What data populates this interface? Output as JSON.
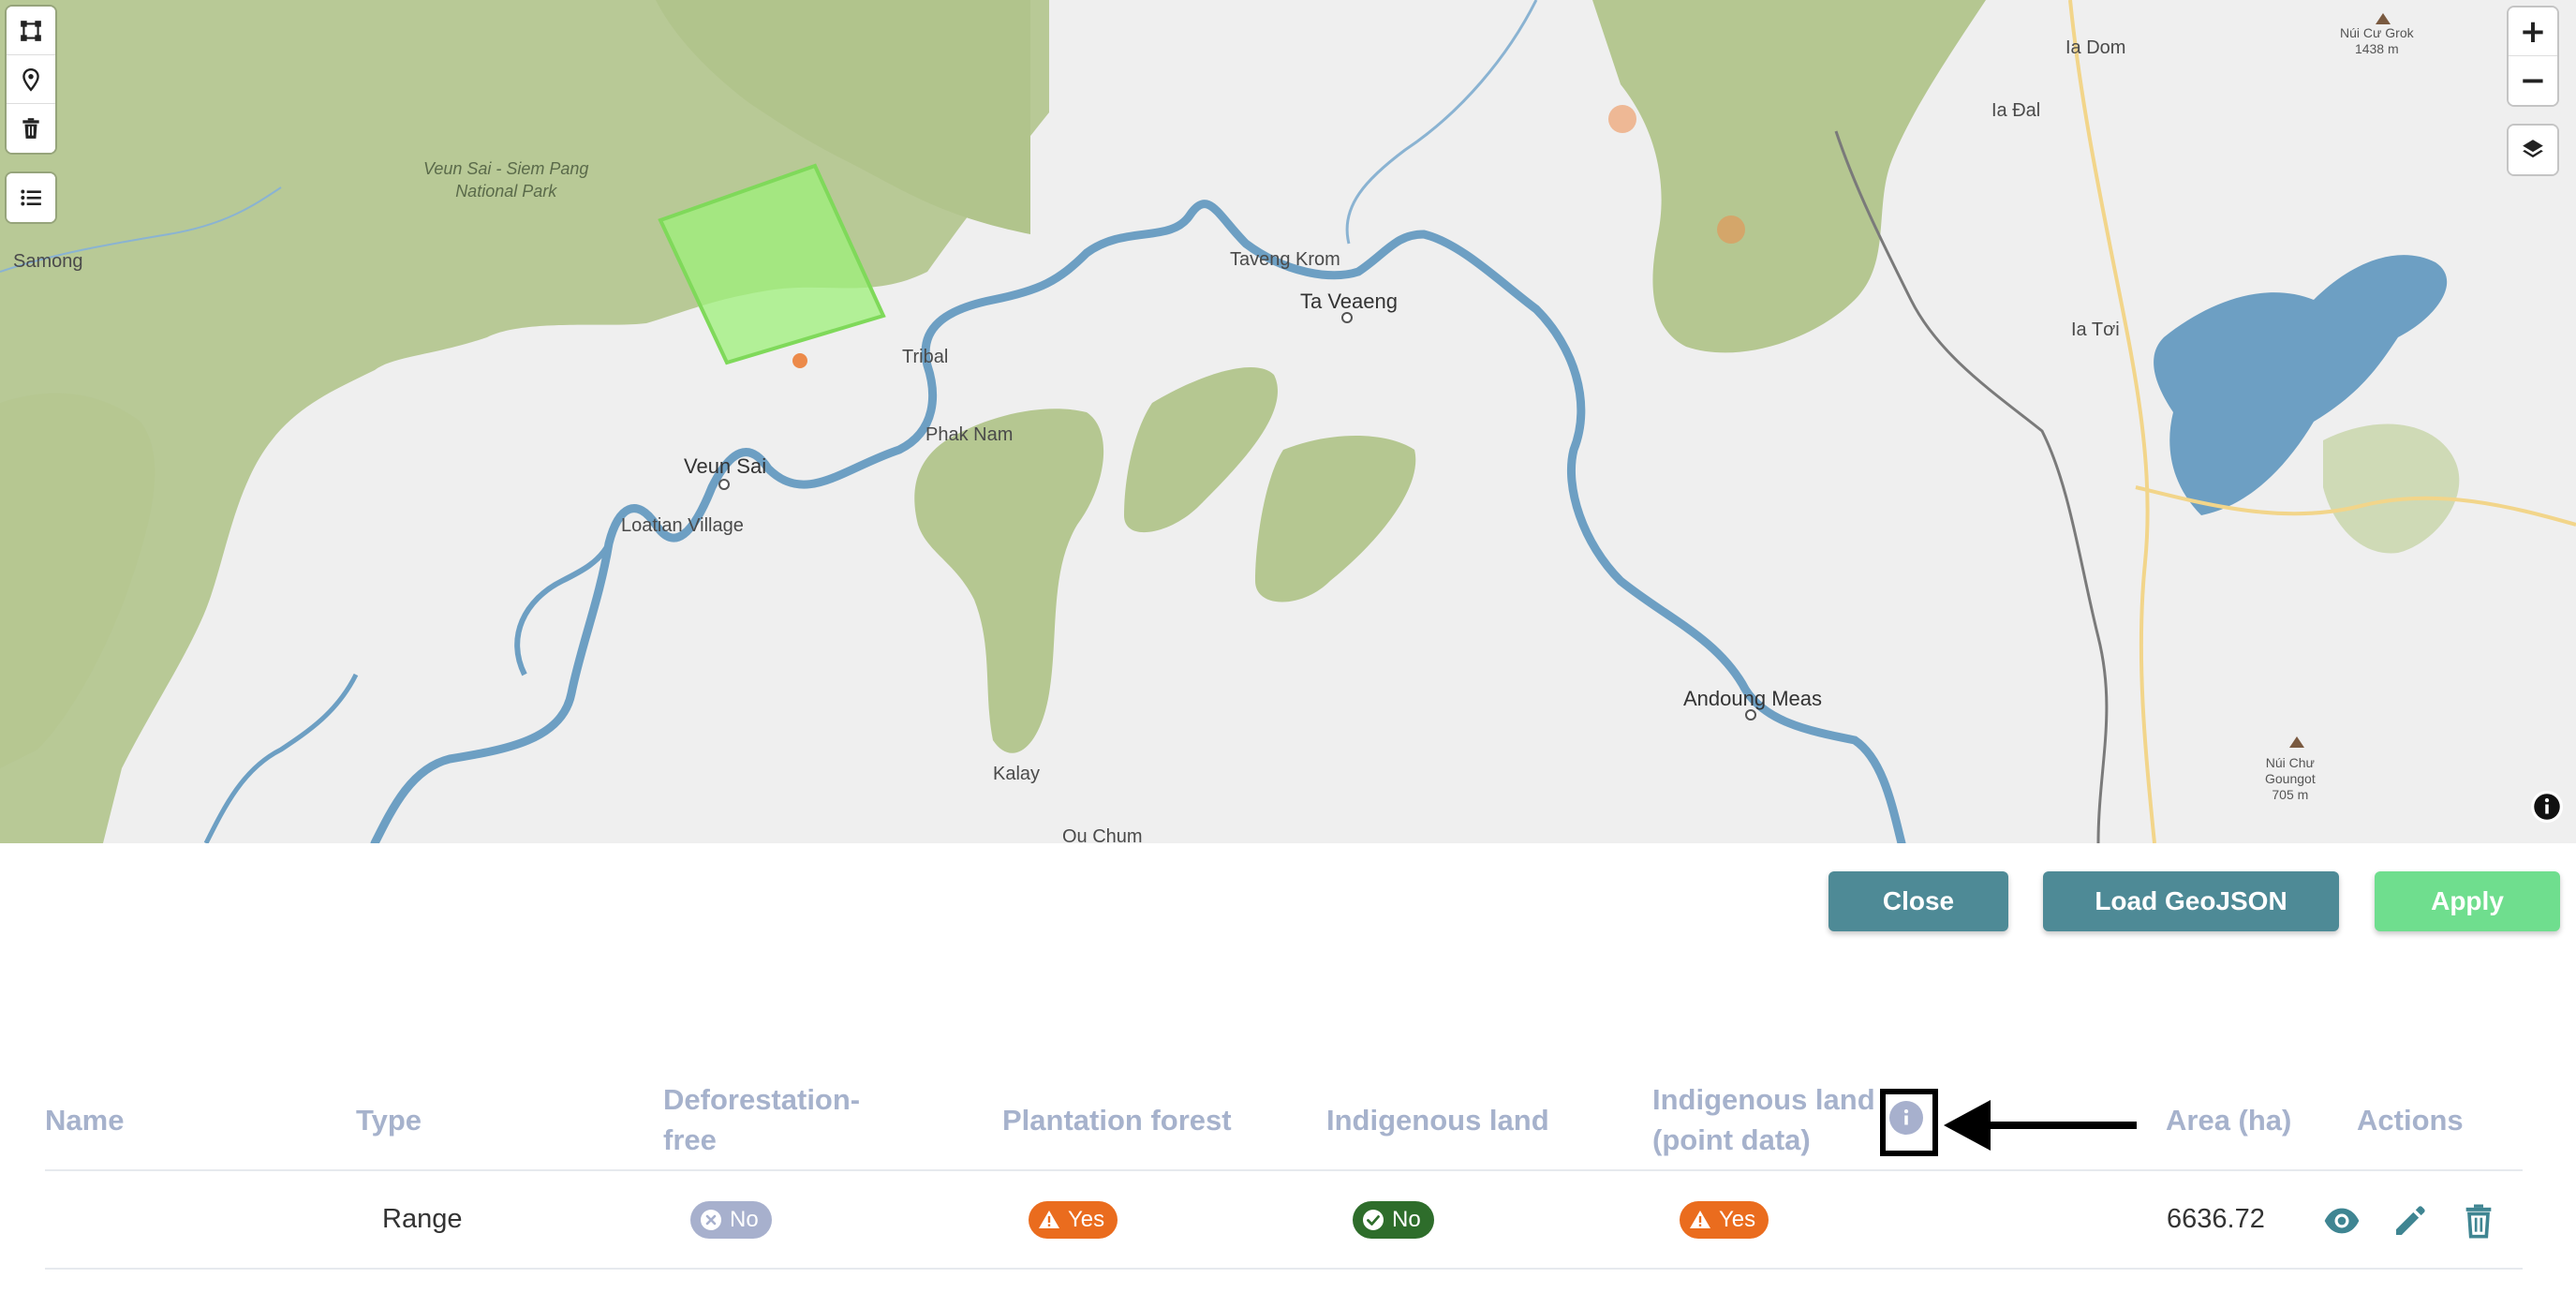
{
  "map": {
    "labels": {
      "park": "Veun Sai - Siem Pang\nNational Park",
      "samong": "Samong",
      "taveng_krom": "Taveng Krom",
      "ta_veaeng": "Ta Veaeng",
      "tribal": "Tribal",
      "phak_nam": "Phak Nam",
      "veun_sai": "Veun Sai",
      "loatian_village": "Loatian Village",
      "kalay": "Kalay",
      "ou_chum": "Ou Chum",
      "andoung_meas": "Andoung Meas",
      "ia_dom": "Ia Dom",
      "ia_dal": "Ia Đal",
      "ia_toi": "Ia Tơi",
      "nui_cu_grok": "Núi Cư Grok\n1438 m",
      "nui_chu_goungot": "Núi Chư\nGoungot\n705 m"
    },
    "controls": {
      "draw_polygon": "polygon-draw-icon",
      "draw_marker": "marker-icon",
      "delete": "trash-icon",
      "list": "list-icon",
      "zoom_in": "+",
      "zoom_out": "−",
      "layers": "layers-icon"
    },
    "colors": {
      "forest": "#b5c791",
      "river": "#6d9fc3",
      "selection": "#9ef07a",
      "point": "#ec8a4a"
    }
  },
  "actions": {
    "close": "Close",
    "load_geojson": "Load GeoJSON",
    "apply": "Apply"
  },
  "table": {
    "headers": {
      "name": "Name",
      "type": "Type",
      "deforestation_line1": "Deforestation-",
      "deforestation_line2": "free",
      "plantation": "Plantation forest",
      "indigenous": "Indigenous land",
      "indigenous_point_line1": "Indigenous land",
      "indigenous_point_line2": "(point data)",
      "area": "Area (ha)",
      "actions": "Actions"
    },
    "rows": [
      {
        "name": "",
        "type": "Range",
        "deforestation_free": "No",
        "plantation_forest": "Yes",
        "indigenous_land": "No",
        "indigenous_point": "Yes",
        "area": "6636.72"
      }
    ]
  }
}
